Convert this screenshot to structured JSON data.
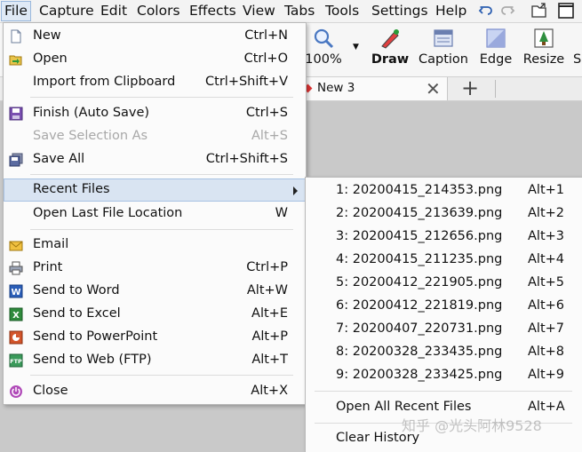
{
  "menubar": {
    "items": [
      "File",
      "Capture",
      "Edit",
      "Colors",
      "Effects",
      "View",
      "Tabs",
      "Tools",
      "Settings",
      "Help"
    ],
    "icons": [
      "undo-icon",
      "redo-icon",
      "open-folder-icon",
      "maximize-icon"
    ]
  },
  "toolbar": {
    "zoom": "100%",
    "buttons": [
      "Draw",
      "Caption",
      "Edge",
      "Resize",
      "S"
    ]
  },
  "tabs": {
    "active": "New 3"
  },
  "file_menu": {
    "items": [
      {
        "label": "New",
        "shortcut": "Ctrl+N",
        "icon": "new-document-icon"
      },
      {
        "label": "Open",
        "shortcut": "Ctrl+O",
        "icon": "open-icon"
      },
      {
        "label": "Import from Clipboard",
        "shortcut": "Ctrl+Shift+V",
        "icon": ""
      },
      {
        "label": "Finish (Auto Save)",
        "shortcut": "Ctrl+S",
        "icon": "save-icon"
      },
      {
        "label": "Save Selection As",
        "shortcut": "Alt+S",
        "icon": "",
        "disabled": true
      },
      {
        "label": "Save All",
        "shortcut": "Ctrl+Shift+S",
        "icon": "save-all-icon"
      },
      {
        "label": "Recent Files",
        "shortcut": "",
        "icon": "",
        "submenu": true
      },
      {
        "label": "Open Last File Location",
        "shortcut": "W",
        "icon": ""
      },
      {
        "label": "Email",
        "shortcut": "",
        "icon": "email-icon"
      },
      {
        "label": "Print",
        "shortcut": "Ctrl+P",
        "icon": "print-icon"
      },
      {
        "label": "Send to Word",
        "shortcut": "Alt+W",
        "icon": "word-icon"
      },
      {
        "label": "Send to Excel",
        "shortcut": "Alt+E",
        "icon": "excel-icon"
      },
      {
        "label": "Send to PowerPoint",
        "shortcut": "Alt+P",
        "icon": "powerpoint-icon"
      },
      {
        "label": "Send to Web (FTP)",
        "shortcut": "Alt+T",
        "icon": "ftp-icon"
      },
      {
        "label": "Close",
        "shortcut": "Alt+X",
        "icon": "close-power-icon"
      }
    ]
  },
  "recent_files": {
    "files": [
      {
        "label": "1:  20200415_214353.png",
        "shortcut": "Alt+1"
      },
      {
        "label": "2:  20200415_213639.png",
        "shortcut": "Alt+2"
      },
      {
        "label": "3:  20200415_212656.png",
        "shortcut": "Alt+3"
      },
      {
        "label": "4:  20200415_211235.png",
        "shortcut": "Alt+4"
      },
      {
        "label": "5:  20200412_221905.png",
        "shortcut": "Alt+5"
      },
      {
        "label": "6:  20200412_221819.png",
        "shortcut": "Alt+6"
      },
      {
        "label": "7:  20200407_220731.png",
        "shortcut": "Alt+7"
      },
      {
        "label": "8:  20200328_233435.png",
        "shortcut": "Alt+8"
      },
      {
        "label": "9:  20200328_233425.png",
        "shortcut": "Alt+9"
      }
    ],
    "open_all": {
      "label": "Open All Recent Files",
      "shortcut": "Alt+A"
    },
    "clear": {
      "label": "Clear History"
    }
  },
  "watermark": "知乎 @光头阿林9528",
  "colors": {
    "highlight": "#d9e4f2",
    "menu_bg": "#fbfbfb",
    "disabled_text": "#a8a8a8"
  }
}
